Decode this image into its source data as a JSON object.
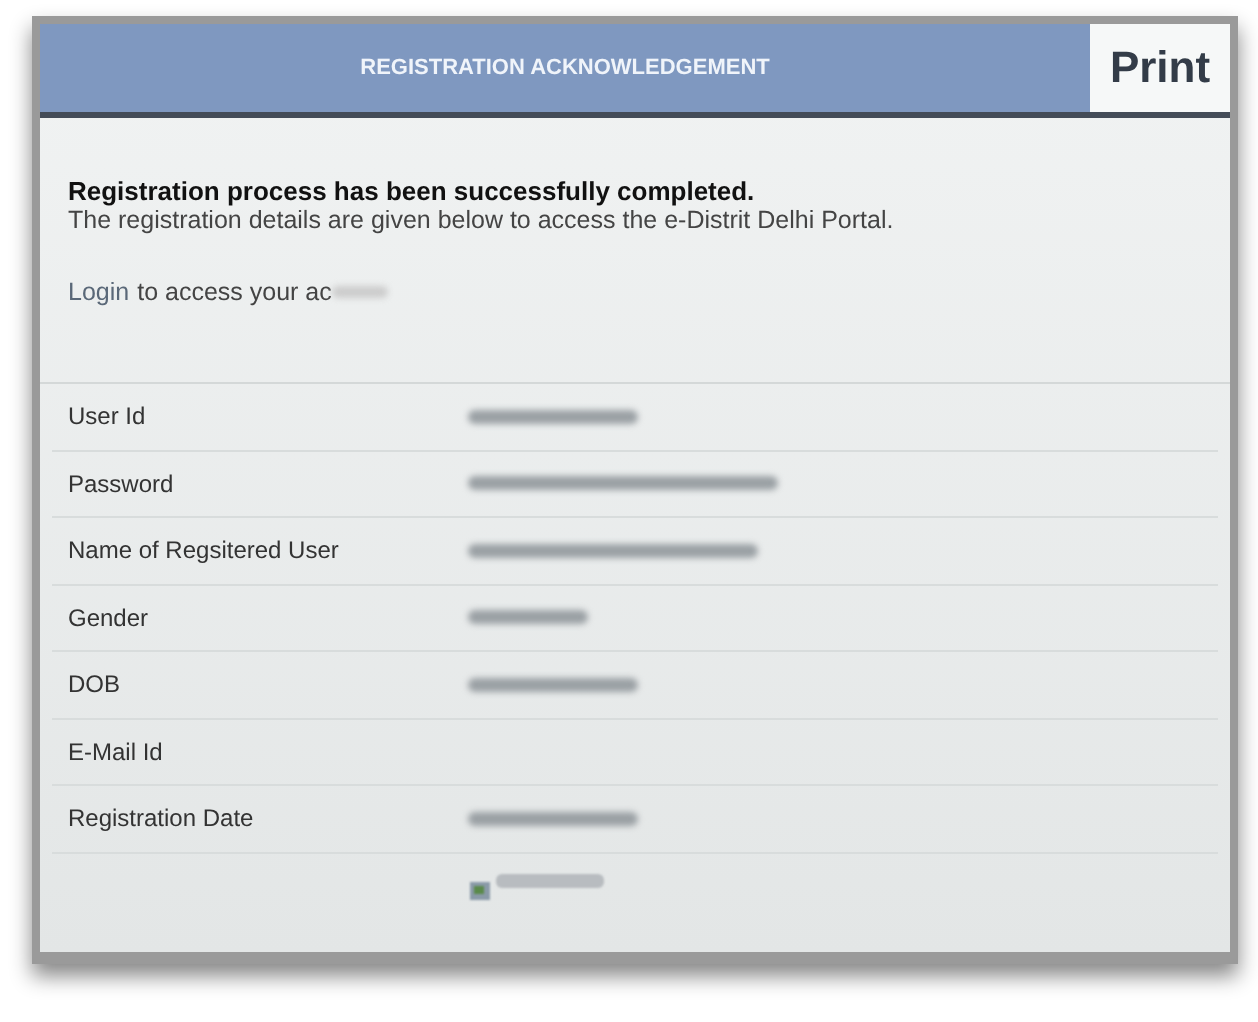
{
  "header": {
    "title": "REGISTRATION ACKNOWLEDGEMENT",
    "print_button": "Print"
  },
  "message": {
    "headline": "Registration process has been successfully completed.",
    "detail": "The registration details are given below to access the e-Distrit Delhi Portal.",
    "login_link": "Login",
    "login_text": "to access your ac"
  },
  "details": [
    {
      "label": "User Id",
      "kind": "blurred"
    },
    {
      "label": "Password",
      "kind": "blurred"
    },
    {
      "label": "Name of Regsitered User",
      "kind": "blurred"
    },
    {
      "label": "Gender",
      "kind": "blurred"
    },
    {
      "label": "DOB",
      "kind": "blurred"
    },
    {
      "label": "E-Mail Id",
      "kind": "empty"
    },
    {
      "label": "Registration Date",
      "kind": "blurred"
    },
    {
      "kind": "broken-image"
    }
  ]
}
